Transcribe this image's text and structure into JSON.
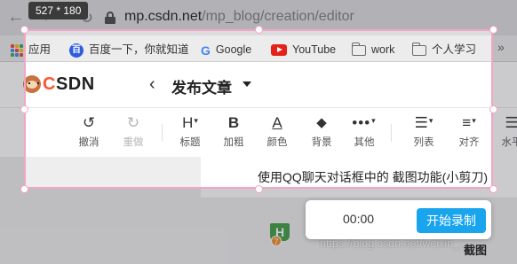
{
  "screenshot_tool": {
    "selection_size_label": "527 * 180",
    "accent_color": "#f3a6c4"
  },
  "browser": {
    "nav": {
      "back_icon": "arrow-left-icon",
      "forward_icon": "arrow-right-icon",
      "reload_icon": "reload-icon"
    },
    "url": {
      "host": "mp.csdn.net",
      "path": "/mp_blog/creation/editor"
    },
    "bookmarks": [
      {
        "label": "应用",
        "icon": "apps-grid-icon"
      },
      {
        "label": "百度一下，你就知道",
        "icon": "baidu-paw-icon"
      },
      {
        "label": "Google",
        "icon": "google-g-icon"
      },
      {
        "label": "YouTube",
        "icon": "youtube-icon"
      },
      {
        "label": "work",
        "icon": "folder-icon"
      },
      {
        "label": "个人学习",
        "icon": "folder-icon"
      }
    ],
    "more_bookmarks": "»"
  },
  "csdn": {
    "logo": "CSDN",
    "header_title": "发布文章",
    "brand_color": "#fc5531",
    "toolbar": [
      {
        "label": "撤消",
        "icon": "undo-icon"
      },
      {
        "label": "重做",
        "icon": "redo-icon"
      },
      {
        "label": "标题",
        "icon": "heading-icon"
      },
      {
        "label": "加粗",
        "icon": "bold-icon"
      },
      {
        "label": "颜色",
        "icon": "text-color-icon"
      },
      {
        "label": "背景",
        "icon": "paint-bucket-icon"
      },
      {
        "label": "其他",
        "icon": "more-icon"
      },
      {
        "label": "列表",
        "icon": "list-icon"
      },
      {
        "label": "对齐",
        "icon": "align-icon"
      },
      {
        "label": "水平",
        "icon": "horizontal-rule-icon"
      }
    ],
    "document_title": "使用QQ聊天对话框中的 截图功能(小剪刀)"
  },
  "recorder": {
    "time": "00:00",
    "start_button": "开始录制",
    "button_color": "#19a4ee"
  },
  "watermark": "https://blog.csdn.net/weixin_...",
  "screenshot_label": "截图"
}
